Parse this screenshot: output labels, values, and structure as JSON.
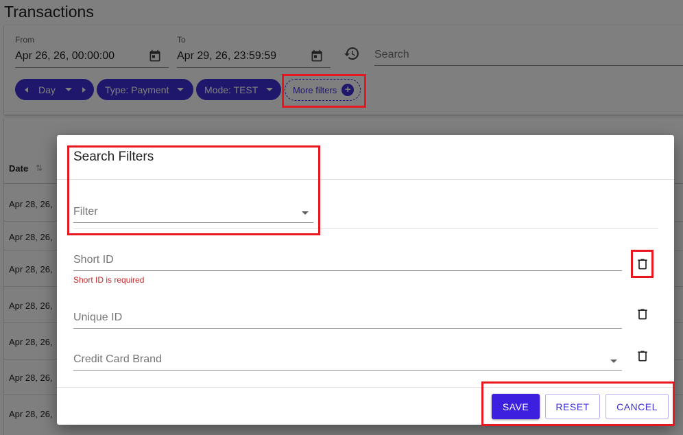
{
  "page": {
    "title": "Transactions"
  },
  "filters": {
    "from_label": "From",
    "from_value": "Apr 26, 26, 00:00:00",
    "to_label": "To",
    "to_value": "Apr 29, 26, 23:59:59",
    "search_placeholder": "Search",
    "chips": {
      "period": "Day",
      "type": "Type: Payment",
      "mode": "Mode: TEST",
      "more": "More filters"
    }
  },
  "table": {
    "date_header": "Date",
    "rows": [
      "Apr 28, 26,",
      "Apr 28, 26,",
      "Apr 28, 26,",
      "Apr 28, 26,",
      "Apr 28, 26,",
      "Apr 28, 26,",
      "Apr 28, 26,"
    ]
  },
  "dialog": {
    "title": "Search Filters",
    "filter_select_label": "Filter",
    "fields": [
      {
        "label": "Short ID",
        "error": "Short ID is required"
      },
      {
        "label": "Unique ID"
      },
      {
        "label": "Credit Card Brand"
      }
    ],
    "buttons": {
      "save": "SAVE",
      "reset": "RESET",
      "cancel": "CANCEL"
    }
  },
  "colors": {
    "primary": "#3d2fd6",
    "highlight": "#e8161f",
    "error": "#c62828"
  },
  "icons": [
    "calendar-icon",
    "history-icon",
    "chevron-left-icon",
    "chevron-right-icon",
    "arrow-drop-down-icon",
    "plus-circle-icon",
    "sort-icon",
    "trash-icon"
  ]
}
